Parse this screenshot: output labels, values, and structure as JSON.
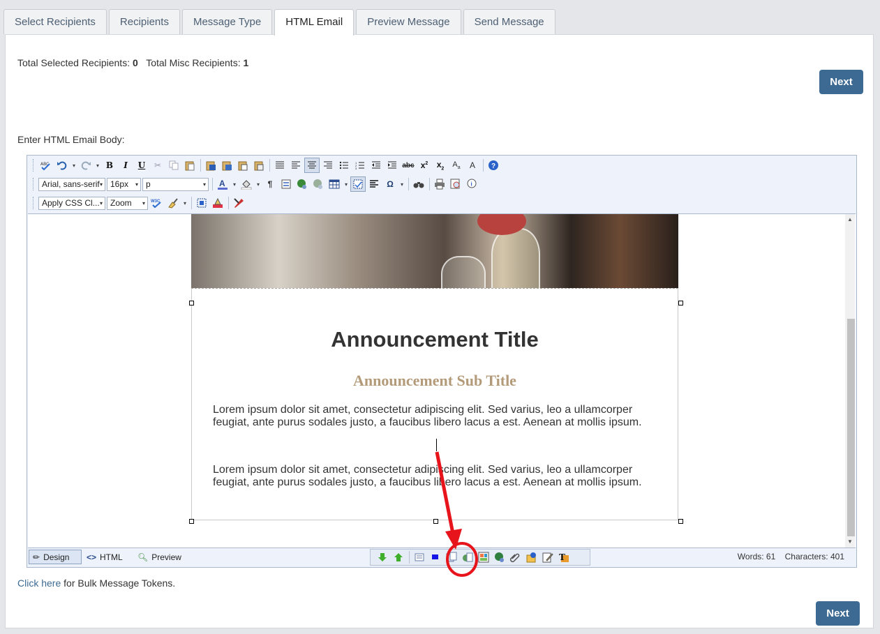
{
  "tabs": [
    {
      "label": "Select Recipients"
    },
    {
      "label": "Recipients"
    },
    {
      "label": "Message Type"
    },
    {
      "label": "HTML Email",
      "active": true
    },
    {
      "label": "Preview Message"
    },
    {
      "label": "Send Message"
    }
  ],
  "summary": {
    "selected_label": "Total Selected Recipients:",
    "selected_value": "0",
    "misc_label": "Total Misc Recipients:",
    "misc_value": "1"
  },
  "next_label": "Next",
  "body_label": "Enter HTML Email Body:",
  "toolbar": {
    "font_family": "Arial, sans-serif",
    "font_size": "16px",
    "format_block": "p",
    "css_class": "Apply CSS Cl...",
    "zoom": "Zoom",
    "w3c_icon_text": "W3C"
  },
  "document": {
    "title": "Announcement Title",
    "subtitle": "Announcement Sub Title",
    "paragraph1": "Lorem ipsum dolor sit amet, consectetur adipiscing elit. Sed varius, leo a ullamcorper feugiat, ante purus sodales justo, a faucibus libero lacus a est. Aenean at mollis ipsum.",
    "paragraph2": "Lorem ipsum dolor sit amet, consectetur adipiscing elit. Sed varius, leo a ullamcorper feugiat, ante purus sodales justo, a faucibus libero lacus a est. Aenean at mollis ipsum."
  },
  "modes": {
    "design": "Design",
    "html": "HTML",
    "preview": "Preview"
  },
  "stats": {
    "words_label": "Words: 61",
    "chars_label": "Characters: 401"
  },
  "bulk": {
    "link_text": "Click here",
    "rest_text": " for Bulk Message Tokens."
  },
  "annotation": {
    "arrow_color": "#e8141b",
    "circle_color": "#e8141b"
  },
  "colors": {
    "button_bg": "#3c6a93",
    "subtitle": "#b39a78",
    "link": "#3c6a93"
  }
}
